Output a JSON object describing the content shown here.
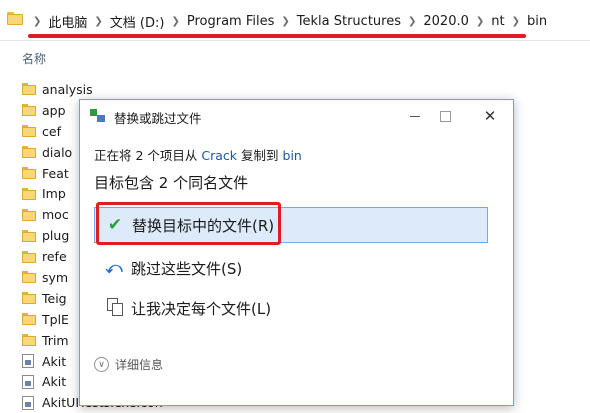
{
  "explorer": {
    "breadcrumb": [
      "此电脑",
      "文档 (D:)",
      "Program Files",
      "Tekla Structures",
      "2020.0",
      "nt",
      "bin"
    ],
    "column_header": "名称",
    "items": [
      {
        "name": "analysis",
        "type": "folder"
      },
      {
        "name": "app",
        "type": "folder"
      },
      {
        "name": "cef",
        "type": "folder"
      },
      {
        "name": "dialo",
        "type": "folder"
      },
      {
        "name": "Feat",
        "type": "folder"
      },
      {
        "name": "Imp",
        "type": "folder"
      },
      {
        "name": "moc",
        "type": "folder"
      },
      {
        "name": "plug",
        "type": "folder"
      },
      {
        "name": "refe",
        "type": "folder"
      },
      {
        "name": "sym",
        "type": "folder"
      },
      {
        "name": "Teig",
        "type": "folder"
      },
      {
        "name": "TplE",
        "type": "folder"
      },
      {
        "name": "Trim",
        "type": "folder"
      },
      {
        "name": "Akit",
        "type": "file"
      },
      {
        "name": "Akit",
        "type": "file"
      },
      {
        "name": "AkitUITests.exe.config",
        "type": "file"
      }
    ]
  },
  "dialog": {
    "title": "替换或跳过文件",
    "progress": {
      "prefix": "正在将 2 个项目从",
      "source": "Crack",
      "middle": "复制到",
      "dest": "bin"
    },
    "headline": "目标包含 2 个同名文件",
    "options": {
      "replace": "替换目标中的文件(R)",
      "skip": "跳过这些文件(S)",
      "decide": "让我决定每个文件(L)"
    },
    "details": "详细信息",
    "window_buttons": {
      "minimize": "minimize",
      "maximize": "maximize",
      "close": "✕"
    }
  },
  "colors": {
    "highlight": "#e21b23",
    "selection_bg": "#dceaf9",
    "link": "#1b57a6",
    "check": "#2a9d3c"
  },
  "icons": {
    "replace": "check-icon",
    "skip": "skip-arrow-icon",
    "decide": "compare-files-icon"
  }
}
